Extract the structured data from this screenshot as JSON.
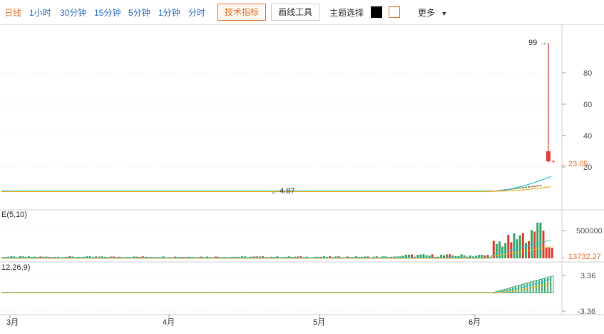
{
  "toolbar": {
    "periods": [
      "日线",
      "1小时",
      "30分钟",
      "15分钟",
      "5分钟",
      "1分钟",
      "分时"
    ],
    "tech_indicator_label": "技术指标",
    "draw_tools_label": "画线工具",
    "theme_label": "主题选择",
    "more_label": "更多",
    "theme_colors": [
      "#000000",
      "#ffffff"
    ]
  },
  "main_panel": {
    "y_ticks": [
      "80",
      "60",
      "40",
      "20"
    ],
    "y_tick_values": [
      80,
      60,
      40,
      20
    ],
    "high_label": "99",
    "low_label": "4.87",
    "current_price": "23.05"
  },
  "volume_panel": {
    "indicator_label": "E(5,10)",
    "y_tick": "500000",
    "current_volume": "13732.27"
  },
  "macd_panel": {
    "indicator_label": "12,26,9)",
    "y_ticks": [
      "3.36",
      "-3.36"
    ]
  },
  "x_axis": {
    "labels": [
      "3月",
      "4月",
      "5月",
      "6月"
    ]
  },
  "colors": {
    "up": "#e0402f",
    "down": "#3aa56a",
    "accent": "#e8742b",
    "link": "#3071c4",
    "ma_cyan": "#2ec4d0",
    "ma_yellow": "#f0b429"
  }
}
